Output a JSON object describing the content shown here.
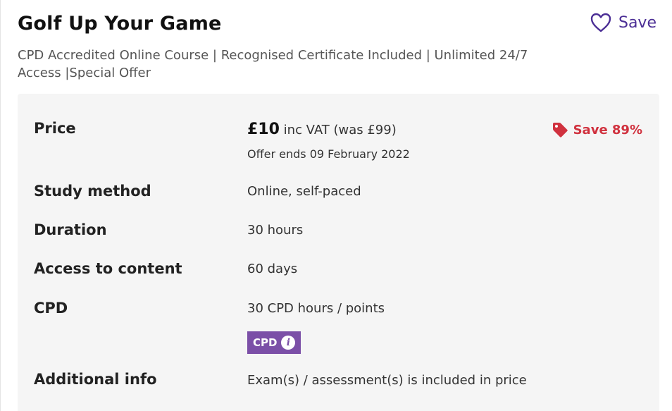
{
  "course": {
    "title": "Golf Up Your Game",
    "subtitle": "CPD Accredited Online Course | Recognised Certificate Included | Unlimited 24/7 Access |Special Offer",
    "save_label": "Save"
  },
  "details": {
    "price": {
      "label": "Price",
      "amount": "£10",
      "vat_text": " inc VAT (was £99)",
      "offer_ends": "Offer ends 09 February 2022",
      "save_badge": "Save 89%"
    },
    "study_method": {
      "label": "Study method",
      "value": "Online, self-paced"
    },
    "duration": {
      "label": "Duration",
      "value": "30 hours"
    },
    "access": {
      "label": "Access to content",
      "value": "60 days"
    },
    "cpd": {
      "label": "CPD",
      "value": "30 CPD hours / points",
      "badge": "CPD",
      "badge_info": "i"
    },
    "additional": {
      "label": "Additional info",
      "value": "Exam(s) / assessment(s) is included in price"
    }
  },
  "colors": {
    "accent": "#4b2e95",
    "sale_red": "#d0313e",
    "cpd_purple": "#7b4fa7",
    "panel_bg": "#f5f5f5"
  },
  "icons": {
    "save": "heart-icon",
    "discount": "price-tag-icon",
    "info": "info-icon"
  }
}
